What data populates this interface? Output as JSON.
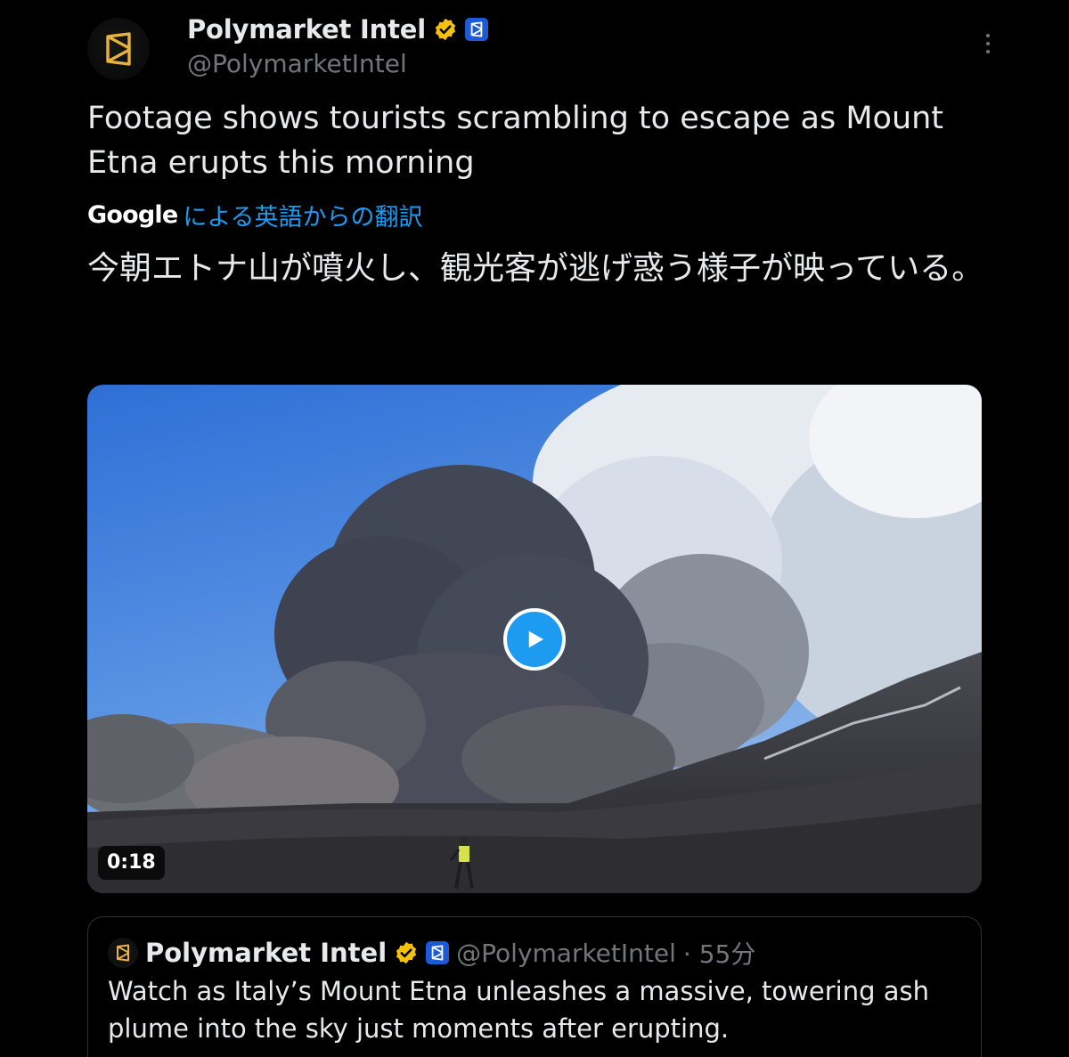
{
  "author": {
    "display_name": "Polymarket Intel",
    "handle": "@PolymarketIntel",
    "verified_icon": "verified-badge-icon",
    "affiliate_icon": "polymarket-affiliate-icon"
  },
  "tweet": {
    "text": "Footage shows tourists scrambling to escape as Mount Etna erupts this morning",
    "translation_provider": "Google",
    "translation_link": "による英語からの翻訳",
    "translated_text": "今朝エトナ山が噴火し、観光客が逃げ惑う様子が映っている。"
  },
  "video": {
    "duration": "0:18",
    "play_icon": "play-icon"
  },
  "quoted_tweet": {
    "display_name": "Polymarket Intel",
    "handle": "@PolymarketIntel",
    "time": "· 55分",
    "text": "Watch as Italy’s Mount Etna unleashes a massive, towering ash plume into the sky just moments after erupting."
  },
  "colors": {
    "background": "#000000",
    "text": "#e7e9ea",
    "secondary": "#71767b",
    "link": "#1d9bf0",
    "gold_badge": "#f4c20d",
    "affiliate": "#1d5bd6"
  }
}
